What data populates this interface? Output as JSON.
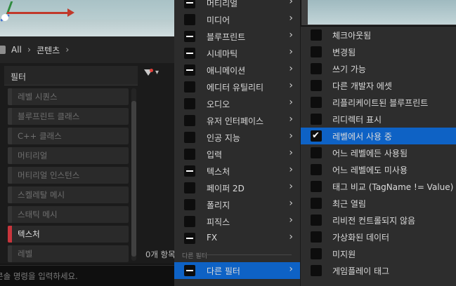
{
  "path": {
    "crumbs": [
      "All",
      "콘텐츠"
    ]
  },
  "filter_panel": {
    "header": "필터",
    "items": [
      {
        "label": "레벨 시퀀스",
        "active": false
      },
      {
        "label": "블루프린트 클래스",
        "active": false
      },
      {
        "label": "C++ 클래스",
        "active": false
      },
      {
        "label": "머티리얼",
        "active": false
      },
      {
        "label": "머티리얼 인스턴스",
        "active": false
      },
      {
        "label": "스켈레탈 메시",
        "active": false
      },
      {
        "label": "스태틱 메시",
        "active": false
      },
      {
        "label": "텍스처",
        "active": true
      },
      {
        "label": "레벨",
        "active": false
      }
    ],
    "count_text": "0개 항목",
    "active_color": "#c8353c"
  },
  "console": {
    "placeholder": "콘솔 명령을 입력하세요."
  },
  "menu1": {
    "items": [
      {
        "label": "머티리얼",
        "state": "partial"
      },
      {
        "label": "미디어",
        "state": "none"
      },
      {
        "label": "블루프린트",
        "state": "partial"
      },
      {
        "label": "시네마틱",
        "state": "partial"
      },
      {
        "label": "애니메이션",
        "state": "partial"
      },
      {
        "label": "에디터 유틸리티",
        "state": "none"
      },
      {
        "label": "오디오",
        "state": "none"
      },
      {
        "label": "유저 인터페이스",
        "state": "none"
      },
      {
        "label": "인공 지능",
        "state": "none"
      },
      {
        "label": "입력",
        "state": "none"
      },
      {
        "label": "텍스처",
        "state": "partial"
      },
      {
        "label": "페이퍼 2D",
        "state": "none"
      },
      {
        "label": "폴리지",
        "state": "none"
      },
      {
        "label": "피직스",
        "state": "none"
      },
      {
        "label": "FX",
        "state": "partial"
      }
    ],
    "section_label": "다른 필터",
    "other_filters": {
      "label": "다른 필터",
      "state": "partial"
    }
  },
  "menu2": {
    "items": [
      {
        "label": "체크아웃됨",
        "checked": false
      },
      {
        "label": "변경됨",
        "checked": false
      },
      {
        "label": "쓰기 가능",
        "checked": false
      },
      {
        "label": "다른 개발자 에셋",
        "checked": false
      },
      {
        "label": "리플리케이트된 블루프린트",
        "checked": false
      },
      {
        "label": "리디렉터 표시",
        "checked": false
      },
      {
        "label": "레벨에서 사용 중",
        "checked": true
      },
      {
        "label": "어느 레벨에든 사용됨",
        "checked": false
      },
      {
        "label": "어느 레벨에도 미사용",
        "checked": false
      },
      {
        "label": "태그 비교 (TagName != Value)",
        "checked": false
      },
      {
        "label": "최근 열림",
        "checked": false
      },
      {
        "label": "리비전 컨트롤되지 않음",
        "checked": false
      },
      {
        "label": "가상화된 데이터",
        "checked": false
      },
      {
        "label": "미지원",
        "checked": false
      },
      {
        "label": "게임플레이 태그",
        "checked": false
      }
    ]
  },
  "colors": {
    "selection": "#0e62c5",
    "menu_bg": "#2c2c2c"
  }
}
